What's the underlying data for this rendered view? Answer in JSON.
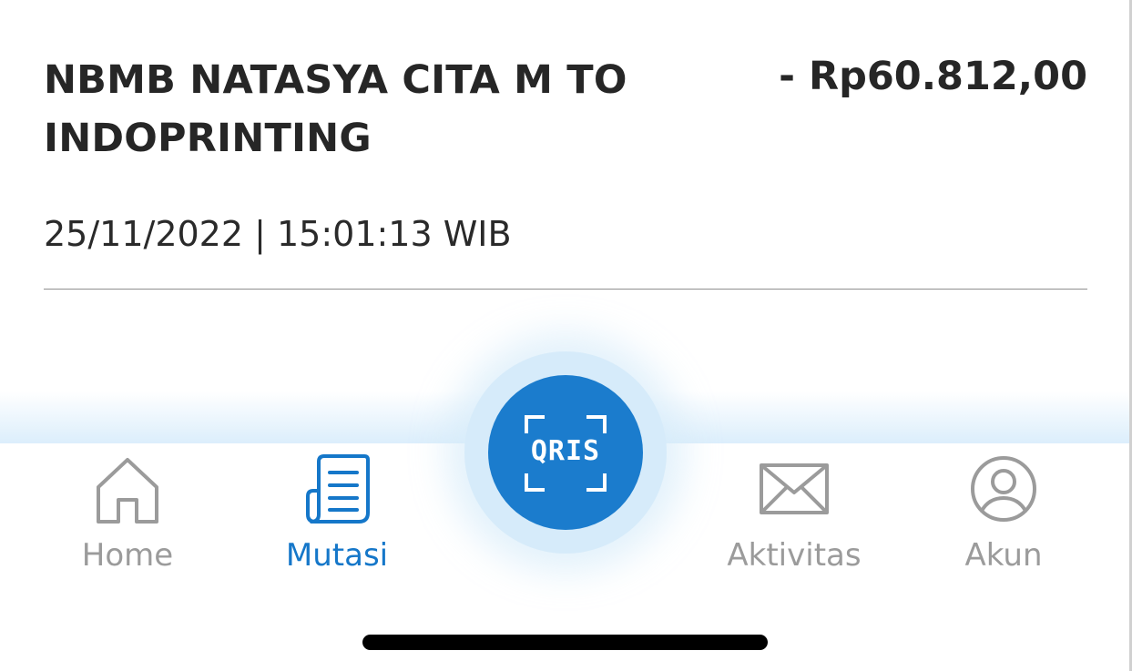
{
  "transaction": {
    "description": "NBMB NATASYA CITA M TO INDOPRINTING",
    "amount": "- Rp60.812,00",
    "datetime": "25/11/2022 | 15:01:13 WIB"
  },
  "bottom_nav": {
    "items": [
      {
        "label": "Home",
        "icon": "home-icon",
        "active": false
      },
      {
        "label": "Mutasi",
        "icon": "document-icon",
        "active": true
      },
      {
        "label": "Aktivitas",
        "icon": "envelope-icon",
        "active": false
      },
      {
        "label": "Akun",
        "icon": "user-circle-icon",
        "active": false
      }
    ],
    "qris": {
      "label": "QRIS",
      "icon": "qris-scan-icon"
    }
  },
  "colors": {
    "active": "#1577c9",
    "inactive": "#9b9b9b",
    "qris_fill": "#1b7ccd",
    "qris_halo": "#d6ebfa",
    "text": "#262626"
  }
}
